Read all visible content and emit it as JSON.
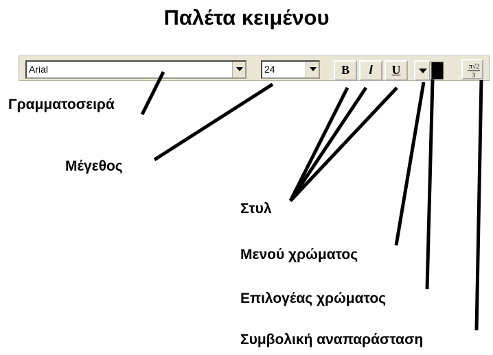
{
  "title": "Παλέτα κειμένου",
  "toolbar": {
    "font_value": "Arial",
    "size_value": "24",
    "bold_label": "B",
    "italic_label": "I",
    "underline_label": "U",
    "swatch_color": "#000000"
  },
  "labels": {
    "font": "Γραμματοσειρά",
    "size": "Μέγεθος",
    "style": "Στυλ",
    "color_menu": "Μενού χρώματος",
    "color_picker": "Επιλογέας χρώματος",
    "symbolic": "Συμβολική αναπαράσταση"
  }
}
